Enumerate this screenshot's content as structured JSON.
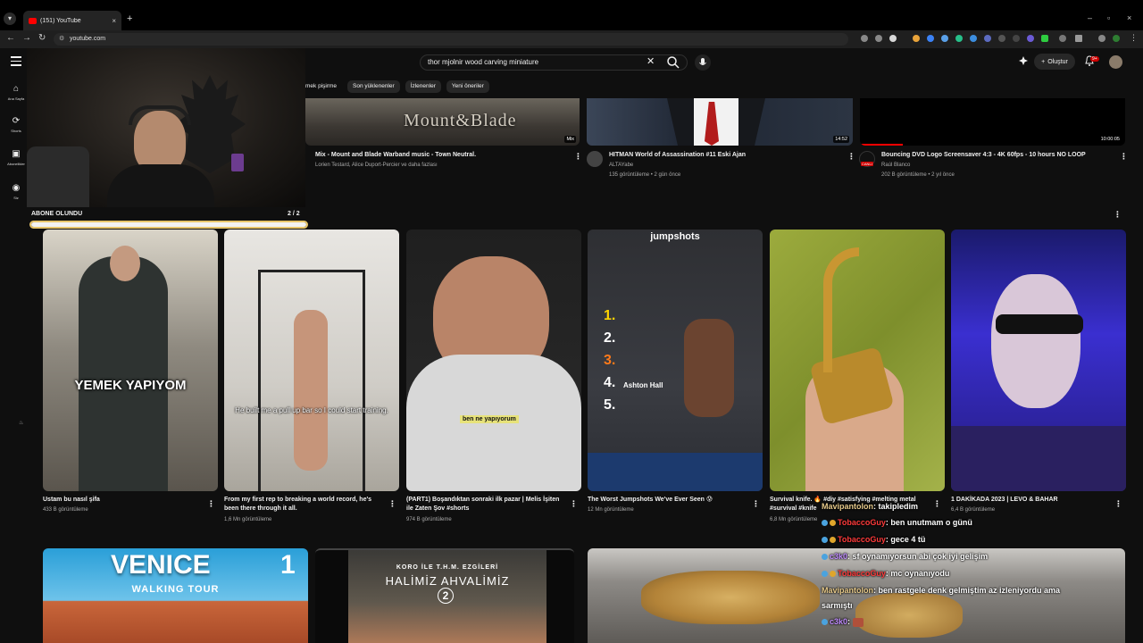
{
  "browser": {
    "tab_title": "(151) YouTube",
    "tab_close": "×",
    "new_tab": "+",
    "url": "youtube.com",
    "window_controls": [
      "–",
      "▫",
      "×"
    ]
  },
  "header": {
    "search_value": "thor mjolnir wood carving miniature",
    "create_label": "Oluştur",
    "notif_count": "9+"
  },
  "rail": [
    {
      "label": "Ana Sayfa",
      "icon": "home-icon"
    },
    {
      "label": "Shorts",
      "icon": "shorts-icon"
    },
    {
      "label": "Abonelikler",
      "icon": "subscriptions-icon"
    },
    {
      "label": "Siz",
      "icon": "you-icon"
    }
  ],
  "chips": [
    "mek pişirme",
    "Son yüklenenler",
    "İzlenenler",
    "Yeni öneriler"
  ],
  "top_videos": [
    {
      "title": "Mix - Mount and Blade Warband music - Town Neutral.",
      "sub1": "Lorien Testard, Alice Duport-Percier ve daha fazlası",
      "sub2": "",
      "badge": "Mix",
      "thumb_text": "Mount&Blade"
    },
    {
      "title": "HITMAN World of Assassination #11 Eski Ajan",
      "sub1": "ALTAYabe",
      "sub2": "135 görüntüleme • 2 gün önce",
      "duration": "14:52"
    },
    {
      "title": "Bouncing DVD Logo Screensaver 4:3 - 4K 60fps - 10 hours NO LOOP",
      "sub1": "Raúl Blanco",
      "sub2": "202 B görüntüleme • 2 yıl önce",
      "duration": "10:00:05",
      "live": "CANLI"
    }
  ],
  "overlay": {
    "label": "ABONE OLUNDU",
    "count": "2  / 2",
    "progress": 1.0
  },
  "shorts": [
    {
      "title": "Ustam bu nasıl şifa",
      "views": "433 B görüntüleme",
      "caption": "YEMEK YAPIYOM"
    },
    {
      "title": "From my first rep to breaking a world record, he's been there through it all.",
      "views": "1,6 Mn görüntüleme",
      "caption": "He built me a pull up bar so I could start training."
    },
    {
      "title": "(PART1) Boşandıktan sonraki ilk pazar | Melis İşiten ile Zaten Şov #shorts",
      "views": "974 B görüntüleme",
      "caption": "ben ne yapıyorum"
    },
    {
      "title": "The Worst Jumpshots We've Ever Seen 😰",
      "views": "12 Mn görüntüleme",
      "caption": "jumpshots",
      "list": [
        "1.",
        "2.",
        "3.",
        "4.",
        "5."
      ],
      "name_tag": "Ashton Hall"
    },
    {
      "title": "Survival knife. 🔥 #diy #satisfying #melting metal #survival #knife",
      "views": "6,8 Mn görüntüleme",
      "caption": ""
    },
    {
      "title": "1 DAKİKADA 2023 | LEVO & BAHAR",
      "views": "6,4 B görüntüleme",
      "caption": ""
    }
  ],
  "bottom_videos": [
    {
      "title_big": "VENICE",
      "subtitle": "WALKING TOUR",
      "number": "1"
    },
    {
      "title_big": "KORO İLE T.H.M. EZGİLERİ",
      "subtitle": "HALİMİZ AHVALİMİZ",
      "number": "2"
    },
    {
      "title_big": "",
      "subtitle": "",
      "number": ""
    }
  ],
  "chat": [
    {
      "user": "Mavipantolon",
      "text": ": takipledim",
      "color": "#e6c98a"
    },
    {
      "user": "TobaccoGuy",
      "text": ": ben unutmam o günü",
      "color": "#ff3b3b"
    },
    {
      "user": "TobaccoGuy",
      "text": ": gece 4 tü",
      "color": "#ff3b3b"
    },
    {
      "user": "c3k0",
      "text": ": sf oynamıyorsun abi çok iyi gelişim",
      "color": "#c08cff"
    },
    {
      "user": "TobaccoGuy",
      "text": ": mc oynanıyodu",
      "color": "#ff3b3b"
    },
    {
      "user": "Mavipantolon",
      "text": ": ben rastgele denk gelmiştim az izleniyordu ama",
      "color": "#e6c98a"
    },
    {
      "user": "",
      "text": "sarmıştı",
      "color": "#ffffff"
    },
    {
      "user": "c3k0",
      "text": ":",
      "color": "#c08cff"
    }
  ]
}
